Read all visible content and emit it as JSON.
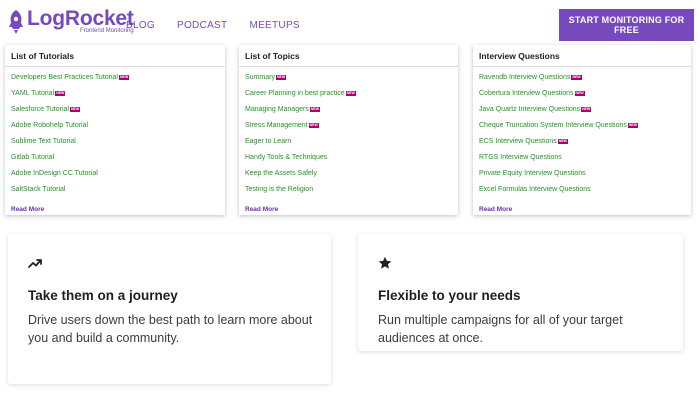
{
  "header": {
    "logo_title": "LogRocket",
    "logo_subtitle": "Frontend Monitoring",
    "nav": [
      "BLOG",
      "PODCAST",
      "MEETUPS"
    ],
    "cta_label": "START MONITORING FOR FREE"
  },
  "colors": {
    "brand": "#764abc",
    "link_green": "#2e8b2e",
    "new_badge": "#b0006e"
  },
  "topic_cards": [
    {
      "title": "List of Tutorials",
      "items": [
        {
          "label": "Developers Best Practices Tutorial",
          "badge": "NEW"
        },
        {
          "label": "YAML Tutorial",
          "badge": "NEW"
        },
        {
          "label": "Salesforce Tutorial",
          "badge": "NEW"
        },
        {
          "label": "Adobe Robohelp Tutorial",
          "badge": ""
        },
        {
          "label": "Sublime Text Tutorial",
          "badge": ""
        },
        {
          "label": "Gitlab Tutorial",
          "badge": ""
        },
        {
          "label": "Adobe InDesign CC Tutorial",
          "badge": ""
        },
        {
          "label": "SaltStack Tutorial",
          "badge": ""
        }
      ],
      "read_more": "Read More"
    },
    {
      "title": "List of Topics",
      "items": [
        {
          "label": "Summary",
          "badge": "NEW"
        },
        {
          "label": "Career Planning in best practice",
          "badge": "NEW"
        },
        {
          "label": "Managing Managers",
          "badge": "NEW"
        },
        {
          "label": "Stress Management",
          "badge": "NEW"
        },
        {
          "label": "Eager to Learn",
          "badge": ""
        },
        {
          "label": "Handy Tools & Techniques",
          "badge": ""
        },
        {
          "label": "Keep the Assets Safely",
          "badge": ""
        },
        {
          "label": "Testing is the Religion",
          "badge": ""
        }
      ],
      "read_more": "Read More"
    },
    {
      "title": "Interview Questions",
      "items": [
        {
          "label": "Ravendb Interview Questions",
          "badge": "NEW"
        },
        {
          "label": "Cobertura Interview Questions",
          "badge": "NEW"
        },
        {
          "label": "Java Quartz Interview Questions",
          "badge": "NEW"
        },
        {
          "label": "Cheque Truncation System Interview Questions",
          "badge": "NEW"
        },
        {
          "label": "ECS Interview Questions",
          "badge": "NEW"
        },
        {
          "label": "RTGS Interview Questions",
          "badge": ""
        },
        {
          "label": "Private Equity Interview Questions",
          "badge": ""
        },
        {
          "label": "Excel Formulas Interview Questions",
          "badge": ""
        }
      ],
      "read_more": "Read More"
    }
  ],
  "feature_cards": [
    {
      "icon": "trending-up-icon",
      "title": "Take them on a journey",
      "description": "Drive users down the best path to learn more about you and build a community."
    },
    {
      "icon": "star-icon",
      "title": "Flexible to your needs",
      "description": "Run multiple campaigns for all of your target audiences at once."
    }
  ]
}
